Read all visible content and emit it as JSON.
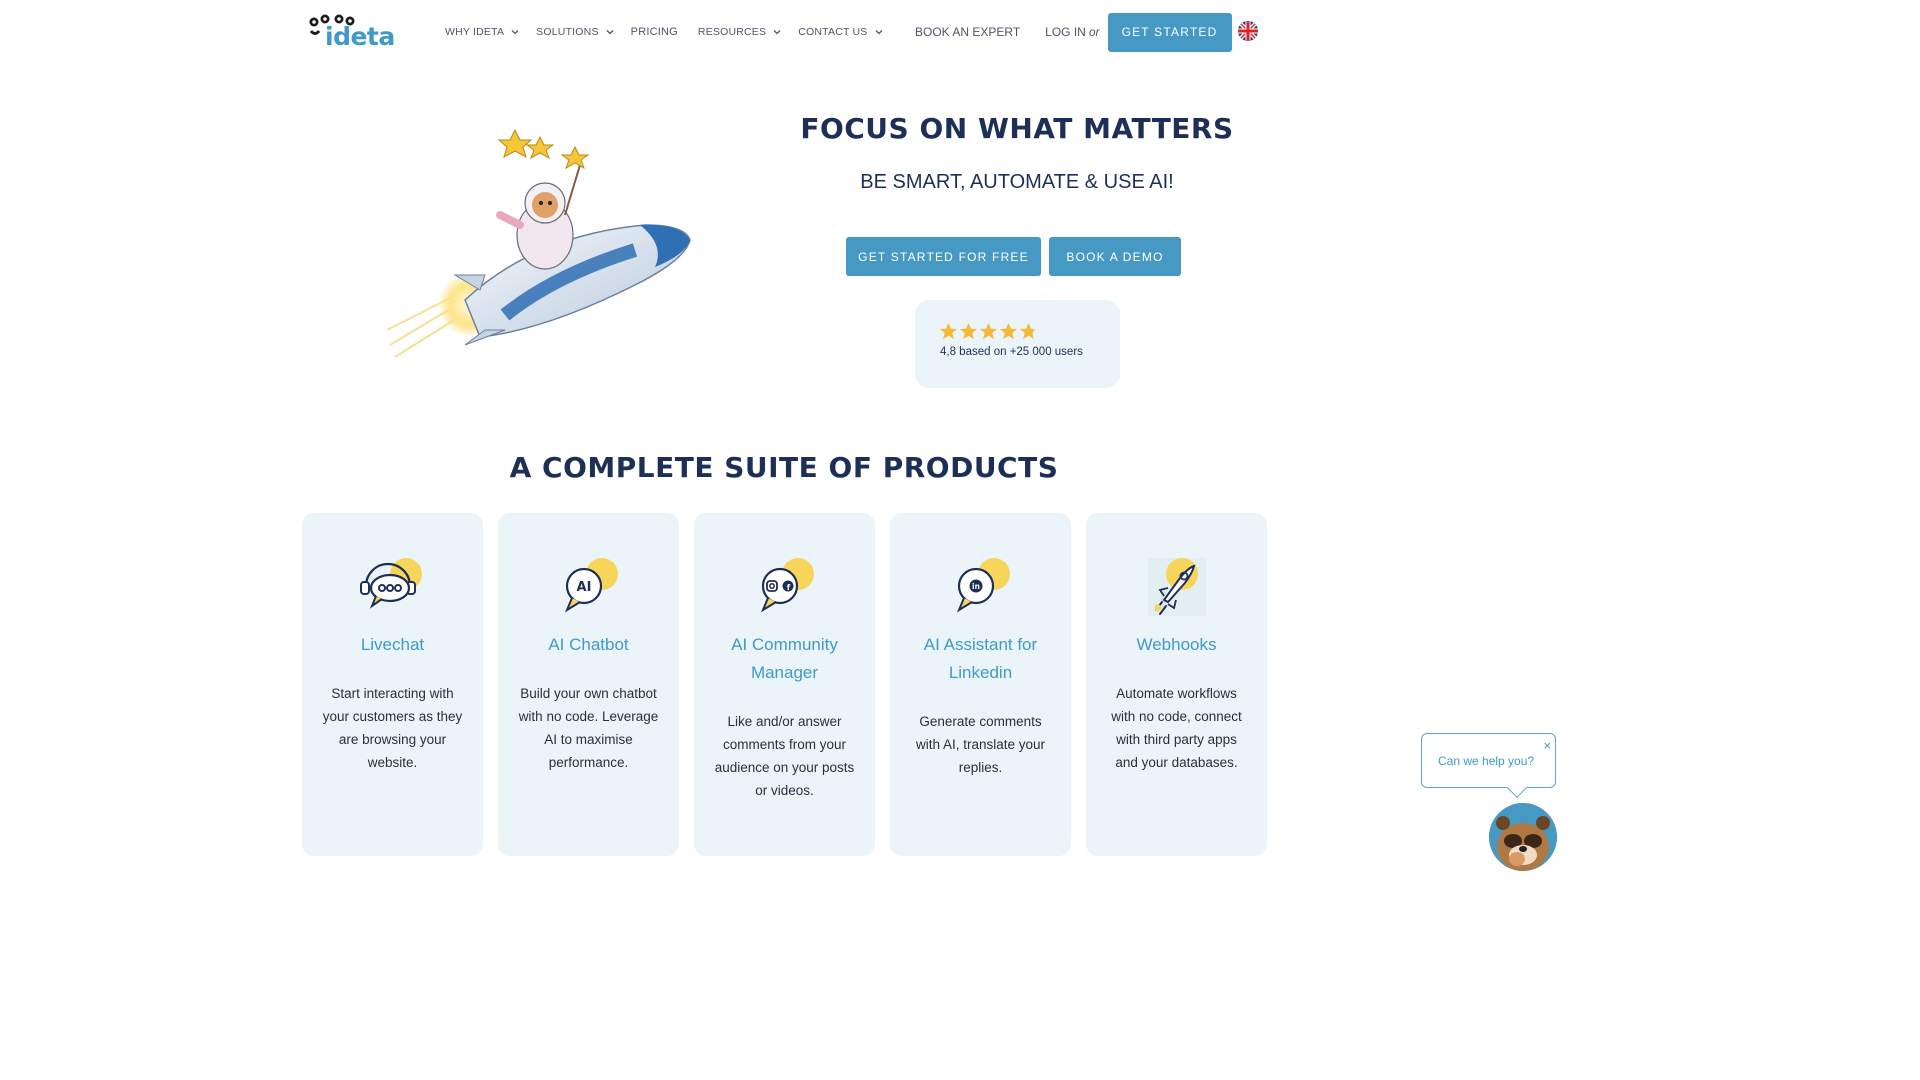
{
  "brand": {
    "name": "ideta"
  },
  "nav": {
    "items": [
      {
        "label": "WHY IDETA",
        "has_dropdown": true
      },
      {
        "label": "SOLUTIONS",
        "has_dropdown": true
      },
      {
        "label": "PRICING",
        "has_dropdown": false
      },
      {
        "label": "RESOURCES",
        "has_dropdown": true
      },
      {
        "label": "CONTACT US",
        "has_dropdown": true
      }
    ],
    "book_expert": "BOOK AN EXPERT",
    "login": "LOG IN",
    "or": "or",
    "get_started": "GET STARTED",
    "language_flag": "uk-flag-icon"
  },
  "hero": {
    "title": "FOCUS ON WHAT MATTERS",
    "subtitle": "BE SMART, AUTOMATE & USE AI!",
    "cta_primary": "GET STARTED FOR FREE",
    "cta_secondary": "BOOK A DEMO",
    "rating": {
      "stars": 4.8,
      "max_stars": 5,
      "text": "4,8 based on +25 000 users"
    }
  },
  "products": {
    "title": "A COMPLETE SUITE OF PRODUCTS",
    "cards": [
      {
        "title": "Livechat",
        "desc": "Start interacting with your customers as they are browsing your website.",
        "icon": "livechat-icon"
      },
      {
        "title": "AI Chatbot",
        "desc": "Build your own chatbot with no code. Leverage AI to maximise performance.",
        "icon": "ai-chatbot-icon"
      },
      {
        "title": "AI Community Manager",
        "desc": "Like and/or answer comments from your audience on your posts or videos.",
        "icon": "community-icon"
      },
      {
        "title": "AI Assistant for Linkedin",
        "desc": "Generate comments with AI, translate your replies.",
        "icon": "linkedin-icon"
      },
      {
        "title": "Webhooks",
        "desc": "Automate workflows with no code, connect with third party apps and your databases.",
        "icon": "rocket-icon"
      }
    ]
  },
  "chat_widget": {
    "prompt": "Can we help you?",
    "close": "×"
  },
  "colors": {
    "accent": "#4599c3",
    "navy": "#1e2f57",
    "card_bg": "#ebf5f9",
    "star": "#f5b93a"
  }
}
